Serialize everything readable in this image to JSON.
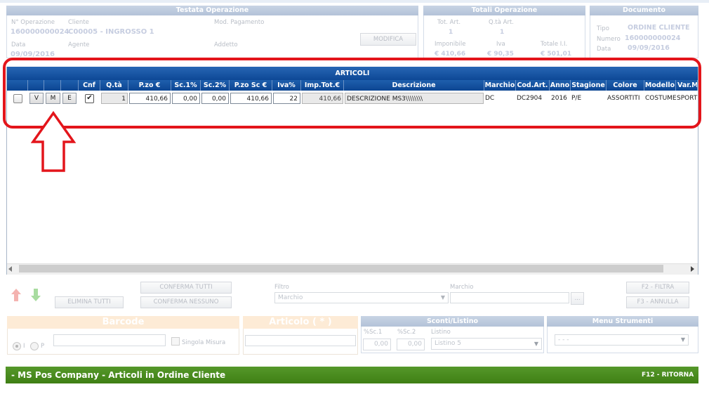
{
  "testata": {
    "title": "Testata Operazione",
    "num_op_label": "N° Operazione",
    "num_op_value": "160000000024",
    "cliente_label": "Cliente",
    "cliente_value": "C00005 - INGROSSO 1",
    "mod_pag_label": "Mod. Pagamento",
    "data_label": "Data",
    "data_value": "09/09/2016",
    "agente_label": "Agente",
    "addetto_label": "Addetto",
    "modifica_button": "MODIFICA"
  },
  "totali": {
    "title": "Totali Operazione",
    "tot_art_label": "Tot. Art.",
    "tot_art_value": "1",
    "qta_art_label": "Q.tà Art.",
    "qta_art_value": "1",
    "imponibile_label": "Imponibile",
    "imponibile_value": "€ 410,66",
    "iva_label": "Iva",
    "iva_value": "€ 90,35",
    "totale_label": "Totale I.I.",
    "totale_value": "€ 501,01"
  },
  "documento": {
    "title": "Documento",
    "tipo_label": "Tipo",
    "tipo_value": "ORDINE CLIENTE",
    "numero_label": "Numero",
    "numero_value": "160000000024",
    "data_label": "Data",
    "data_value": "09/09/2016"
  },
  "articoli": {
    "title": "ARTICOLI",
    "columns": [
      "Cnf",
      "Q.tà",
      "P.zo €",
      "Sc.1%",
      "Sc.2%",
      "P.zo Sc €",
      "Iva%",
      "Imp.Tot.€",
      "Descrizione",
      "Marchio",
      "Cod.Art.",
      "Anno",
      "Stagione",
      "Colore",
      "Modello",
      "Var.M"
    ],
    "row_buttons": [
      "V",
      "M",
      "E"
    ],
    "row": {
      "qta": "1",
      "prezzo": "410,66",
      "sc1": "0,00",
      "sc2": "0,00",
      "prezzo_sc": "410,66",
      "iva": "22",
      "imp_tot": "410,66",
      "descrizione": "DESCRIZIONE MS3\\\\\\\\\\\\\\\\",
      "marchio": "DC",
      "cod_art": "DC2904",
      "anno": "2016",
      "stagione": "P/E",
      "colore": "ASSORTITI",
      "modello": "COSTUME",
      "var_m": "SPORT"
    }
  },
  "toolbar": {
    "elimina_tutti": "ELIMINA TUTTI",
    "conferma_tutti": "CONFERMA TUTTI",
    "conferma_nessuno": "CONFERMA NESSUNO",
    "filtro_label": "Filtro",
    "filtro_value": "Marchio",
    "marchio_label": "Marchio",
    "ellipsis": "...",
    "f2_filtra": "F2 - FILTRA",
    "f3_annulla": "F3 - ANNULLA"
  },
  "barcode": {
    "title": "Barcode",
    "radio_i": "I",
    "radio_p": "P",
    "singola_misura": "Singola Misura"
  },
  "articolo": {
    "title": "Articolo ( * )"
  },
  "sconti": {
    "title": "Sconti/Listino",
    "sc1_label": "%Sc.1",
    "sc1_value": "0,00",
    "sc2_label": "%Sc.2",
    "sc2_value": "0,00",
    "listino_label": "Listino",
    "listino_value": "Listino 5"
  },
  "menu_strumenti": {
    "title": "Menu Strumenti",
    "value": "- - -"
  },
  "footer": {
    "title": "- MS Pos Company - Articoli in Ordine Cliente",
    "f12": "F12 - RITORNA"
  },
  "colors": {
    "grid_header": "#0c4592",
    "footer_bar": "#4a8a17",
    "annotation_red": "#e3151b"
  }
}
